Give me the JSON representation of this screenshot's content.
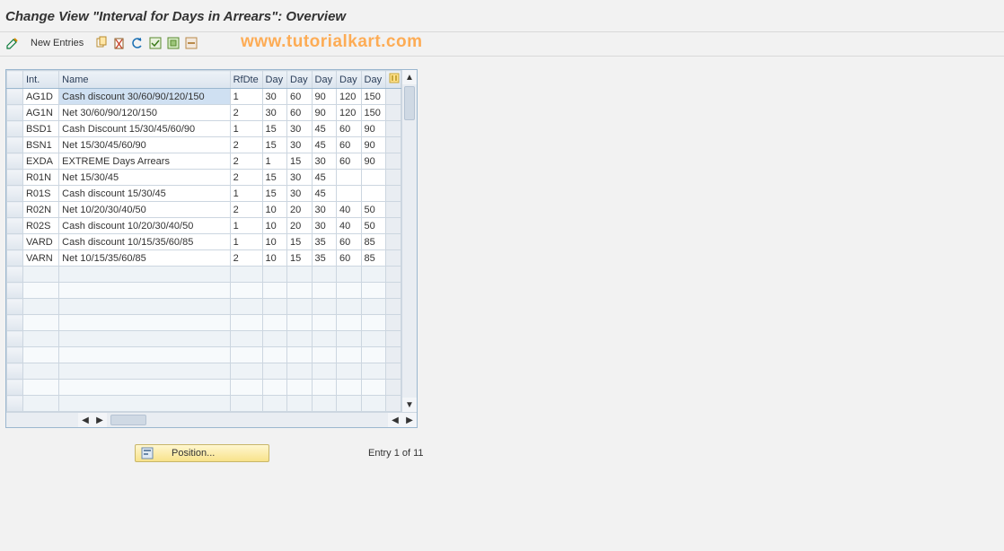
{
  "title": "Change View \"Interval for Days in Arrears\": Overview",
  "watermark": "www.tutorialkart.com",
  "toolbar": {
    "new_entries": "New Entries"
  },
  "columns": {
    "rowsel": "",
    "int": "Int.",
    "name": "Name",
    "rfdte": "RfDte",
    "day1": "Day",
    "day2": "Day",
    "day3": "Day",
    "day4": "Day",
    "day5": "Day"
  },
  "rows": [
    {
      "int": "AG1D",
      "name": "Cash discount 30/60/90/120/150",
      "rfdte": "1",
      "d1": "30",
      "d2": "60",
      "d3": "90",
      "d4": "120",
      "d5": "150",
      "selected": true
    },
    {
      "int": "AG1N",
      "name": "Net 30/60/90/120/150",
      "rfdte": "2",
      "d1": "30",
      "d2": "60",
      "d3": "90",
      "d4": "120",
      "d5": "150"
    },
    {
      "int": "BSD1",
      "name": "Cash Discount 15/30/45/60/90",
      "rfdte": "1",
      "d1": "15",
      "d2": "30",
      "d3": "45",
      "d4": "60",
      "d5": "90"
    },
    {
      "int": "BSN1",
      "name": "Net 15/30/45/60/90",
      "rfdte": "2",
      "d1": "15",
      "d2": "30",
      "d3": "45",
      "d4": "60",
      "d5": "90"
    },
    {
      "int": "EXDA",
      "name": "EXTREME Days Arrears",
      "rfdte": "2",
      "d1": "1",
      "d2": "15",
      "d3": "30",
      "d4": "60",
      "d5": "90"
    },
    {
      "int": "R01N",
      "name": "Net 15/30/45",
      "rfdte": "2",
      "d1": "15",
      "d2": "30",
      "d3": "45",
      "d4": "",
      "d5": ""
    },
    {
      "int": "R01S",
      "name": "Cash discount 15/30/45",
      "rfdte": "1",
      "d1": "15",
      "d2": "30",
      "d3": "45",
      "d4": "",
      "d5": ""
    },
    {
      "int": "R02N",
      "name": "Net 10/20/30/40/50",
      "rfdte": "2",
      "d1": "10",
      "d2": "20",
      "d3": "30",
      "d4": "40",
      "d5": "50"
    },
    {
      "int": "R02S",
      "name": "Cash discount 10/20/30/40/50",
      "rfdte": "1",
      "d1": "10",
      "d2": "20",
      "d3": "30",
      "d4": "40",
      "d5": "50"
    },
    {
      "int": "VARD",
      "name": "Cash discount 10/15/35/60/85",
      "rfdte": "1",
      "d1": "10",
      "d2": "15",
      "d3": "35",
      "d4": "60",
      "d5": "85"
    },
    {
      "int": "VARN",
      "name": "Net 10/15/35/60/85",
      "rfdte": "2",
      "d1": "10",
      "d2": "15",
      "d3": "35",
      "d4": "60",
      "d5": "85"
    }
  ],
  "blank_rows": 9,
  "footer": {
    "position_label": "Position...",
    "entry_text": "Entry 1 of 11"
  }
}
